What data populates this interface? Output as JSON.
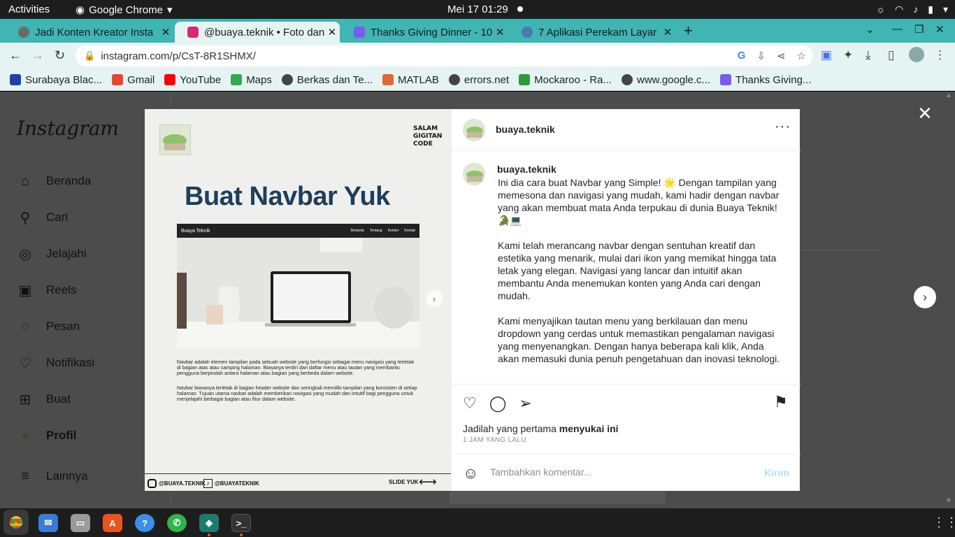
{
  "system": {
    "activities": "Activities",
    "app_name": "Google Chrome",
    "clock": "Mei 17  01:29"
  },
  "tabs": [
    {
      "title": "Jadi Konten Kreator Insta",
      "favicon_color": "#6a6a6a"
    },
    {
      "title": "@buaya.teknik • Foto dan",
      "favicon_color": "#d62976"
    },
    {
      "title": "Thanks Giving Dinner - 10",
      "favicon_color": "#7b5cf0"
    },
    {
      "title": "7 Aplikasi Perekam Layar",
      "favicon_color": "#4a7aa8"
    }
  ],
  "toolbar": {
    "url": "instagram.com/p/CsT-8R1SHMX/"
  },
  "bookmarks": [
    {
      "label": "Surabaya Blac...",
      "icon_color": "#1e40af"
    },
    {
      "label": "Gmail",
      "icon_color": "#ea4335"
    },
    {
      "label": "YouTube",
      "icon_color": "#ff0000"
    },
    {
      "label": "Maps",
      "icon_color": "#34a853"
    },
    {
      "label": "Berkas dan Te...",
      "icon_color": "#444444"
    },
    {
      "label": "MATLAB",
      "icon_color": "#e16737"
    },
    {
      "label": "errors.net",
      "icon_color": "#444444"
    },
    {
      "label": "Mockaroo - Ra...",
      "icon_color": "#2e9a3a"
    },
    {
      "label": "www.google.c...",
      "icon_color": "#444444"
    },
    {
      "label": "Thanks Giving...",
      "icon_color": "#7b5cf0"
    }
  ],
  "instagram": {
    "logo": "Instagram",
    "nav": [
      {
        "label": "Beranda",
        "icon": "home-icon",
        "glyph": "⌂"
      },
      {
        "label": "Cari",
        "icon": "search-icon",
        "glyph": "⚲"
      },
      {
        "label": "Jelajahi",
        "icon": "compass-icon",
        "glyph": "◎"
      },
      {
        "label": "Reels",
        "icon": "reels-icon",
        "glyph": "▣"
      },
      {
        "label": "Pesan",
        "icon": "messenger-icon",
        "glyph": "◌"
      },
      {
        "label": "Notifikasi",
        "icon": "heart-icon",
        "glyph": "♡"
      },
      {
        "label": "Buat",
        "icon": "create-icon",
        "glyph": "⊞"
      },
      {
        "label": "Profil",
        "icon": "profile-avatar",
        "glyph": "●"
      },
      {
        "label": "Lainnya",
        "icon": "menu-icon",
        "glyph": "≡"
      }
    ]
  },
  "post_image": {
    "salam": [
      "SALAM",
      "GIGITAN",
      "CODE"
    ],
    "title": "Buat Navbar Yuk",
    "mock_brand": "Buaya Teknik",
    "mock_links": [
      "Beranda",
      "Tentang",
      "Konten",
      "Kontak"
    ],
    "desc1": "Navbar adalah elemen tampilan pada sebuah website yang berfungsi sebagai menu navigasi yang terletak di bagian atas atau samping halaman. Biasanya terdiri dari daftar menu atau tautan yang membantu pengguna berpindah antara halaman atau bagian yang berbeda dalam website.",
    "desc2": "Navbar biasanya terletak di bagian header website dan seringkali memiliki tampilan yang konsisten di setiap halaman. Tujuan utama navbar adalah memberikan navigasi yang mudah dan intuitif bagi pengguna untuk menjelajahi berbagai bagian atau fitur dalam website.",
    "handle_ig": "@BUAYA.TEKNIK",
    "handle_tt": "@BUAYATEKNIK",
    "slide": "SLIDE YUK"
  },
  "post": {
    "username": "buaya.teknik",
    "caption": [
      "Ini dia cara buat Navbar yang Simple! 🌟 Dengan tampilan yang memesona dan navigasi yang mudah, kami hadir dengan navbar yang akan membuat mata Anda terpukau di dunia Buaya Teknik! 🐊💻",
      "Kami telah merancang navbar dengan sentuhan kreatif dan estetika yang menarik, mulai dari ikon yang memikat hingga tata letak yang elegan. Navigasi yang lancar dan intuitif akan membantu Anda menemukan konten yang Anda cari dengan mudah.",
      "Kami menyajikan tautan menu yang berkilauan dan menu dropdown yang cerdas untuk memastikan pengalaman navigasi yang menyenangkan. Dengan hanya beberapa kali klik, Anda akan memasuki dunia penuh pengetahuan dan inovasi teknologi."
    ],
    "likes_prefix": "Jadilah yang pertama",
    "likes_bold": "menyukai ini",
    "time": "1 JAM YANG LALU",
    "comment_placeholder": "Tambahkan komentar...",
    "post_label": "Kirim"
  },
  "dock": [
    {
      "name": "chrome-app",
      "color": "#e8a33a"
    },
    {
      "name": "thunderbird-app",
      "color": "#3b7bd5"
    },
    {
      "name": "files-app",
      "color": "#9a9a9a"
    },
    {
      "name": "software-app",
      "color": "#e95420"
    },
    {
      "name": "help-app",
      "color": "#3a8ee6"
    },
    {
      "name": "whatsapp-app",
      "color": "#2fb34a"
    },
    {
      "name": "anaconda-app",
      "color": "#1f7a6e"
    },
    {
      "name": "terminal-app",
      "color": "#333333"
    }
  ]
}
